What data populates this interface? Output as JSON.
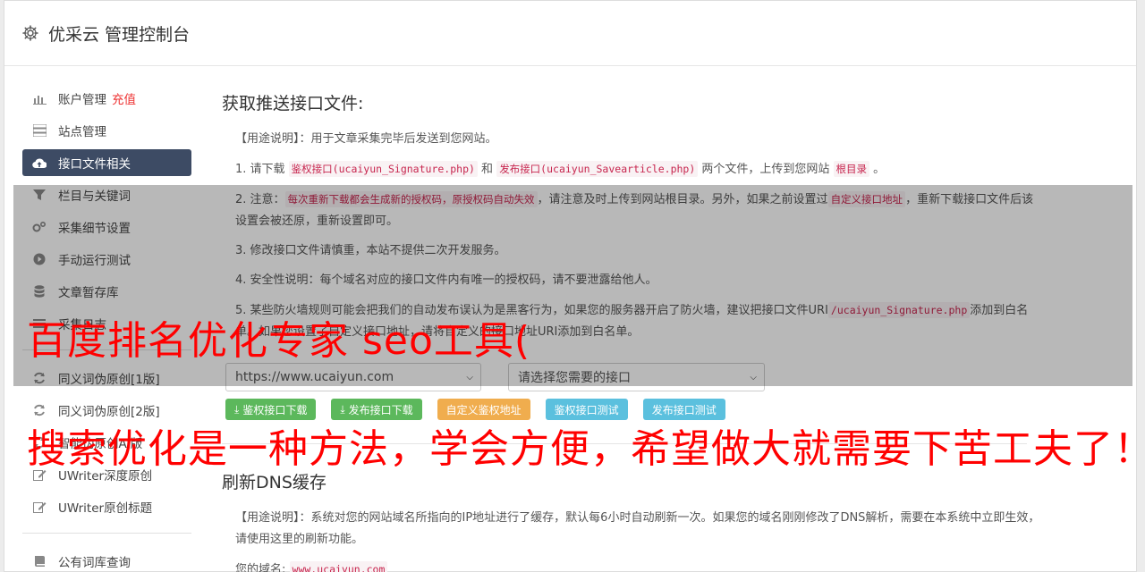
{
  "header": {
    "title": "优采云 管理控制台",
    "icon": "gear-icon"
  },
  "sidebar": {
    "items": [
      {
        "label": "账户管理",
        "extra": "充值",
        "icon": "bar-chart-icon",
        "active": false
      },
      {
        "label": "站点管理",
        "icon": "server-icon",
        "active": false
      },
      {
        "label": "接口文件相关",
        "icon": "cloud-upload-icon",
        "active": true
      },
      {
        "label": "栏目与关键词",
        "icon": "filter-icon",
        "active": false
      },
      {
        "label": "采集细节设置",
        "icon": "cogs-icon",
        "active": false
      },
      {
        "label": "手动运行测试",
        "icon": "play-circle-icon",
        "active": false
      },
      {
        "label": "文章暂存库",
        "icon": "database-icon",
        "active": false
      },
      {
        "label": "采集日志",
        "icon": "list-icon",
        "active": false
      }
    ],
    "items2": [
      {
        "label": "同义词伪原创[1版]",
        "icon": "refresh-icon"
      },
      {
        "label": "同义词伪原创[2版]",
        "icon": "refresh-icon"
      },
      {
        "label": "智能伪原创AI版",
        "icon": "refresh-icon"
      },
      {
        "label": "UWriter深度原创",
        "icon": "edit-icon"
      },
      {
        "label": "UWriter原创标题",
        "icon": "edit-icon"
      }
    ],
    "items3": [
      {
        "label": "公有词库查询",
        "icon": "book-icon"
      }
    ]
  },
  "section1": {
    "title": "获取推送接口文件:",
    "usage": "【用途说明】：用于文章采集完毕后发送到您网站。",
    "step1": {
      "a": "1. 请下载 ",
      "code1": "鉴权接口(ucaiyun_Signature.php)",
      "b": " 和 ",
      "code2": "发布接口(ucaiyun_Savearticle.php)",
      "c": " 两个文件，上传到您网站 ",
      "code3": "根目录",
      "d": " 。"
    },
    "step2": {
      "a": "2. 注意：",
      "code1": "每次重新下载都会生成新的授权码，原授权码自动失效",
      "b": "，请注意及时上传到网站根目录。另外，如果之前设置过",
      "code2": "自定义接口地址",
      "c": "，重新下载接口文件后该设置会被还原，重新设置即可。"
    },
    "step3": "3. 修改接口文件请慎重，本站不提供二次开发服务。",
    "step4": "4. 安全性说明：每个域名对应的接口文件内有唯一的授权码，请不要泄露给他人。",
    "step5": {
      "a": "5. 某些防火墙规则可能会把我们的自动发布误认为是黑客行为，如果您的服务器开启了防火墙，建议把接口文件URI",
      "code1": "/ucaiyun_Signature.php",
      "b": "添加到白名单。如果您设置了自定义接口地址，请将自定义的接口地址URI添加到白名单。"
    },
    "site_select": "https://www.ucaiyun.com",
    "api_select": "请选择您需要的接口",
    "buttons": {
      "download_auth": "鉴权接口下载",
      "download_publish": "发布接口下载",
      "custom_auth": "自定义鉴权地址",
      "test_auth": "鉴权接口测试",
      "test_publish": "发布接口测试"
    }
  },
  "section2": {
    "title": "刷新DNS缓存",
    "usage": "【用途说明】：系统对您的网站域名所指向的IP地址进行了缓存，默认每6小时自动刷新一次。如果您的域名刚刚修改了DNS解析，需要在本系统中立即生效，请使用这里的刷新功能。",
    "domain_label": "您的域名:",
    "domain_value": "www.ucaiyun.com"
  },
  "overlay_text": {
    "line1": "百度排名优化专家 seo工具(",
    "line2": "搜索优化是一种方法，学会方便，希望做大就需要下苦工夫了！)"
  },
  "colors": {
    "accent": "#3d4b64",
    "banner": "#ff0000",
    "green": "#5cb85c",
    "orange": "#f0ad4e",
    "blue": "#5bc0de"
  }
}
